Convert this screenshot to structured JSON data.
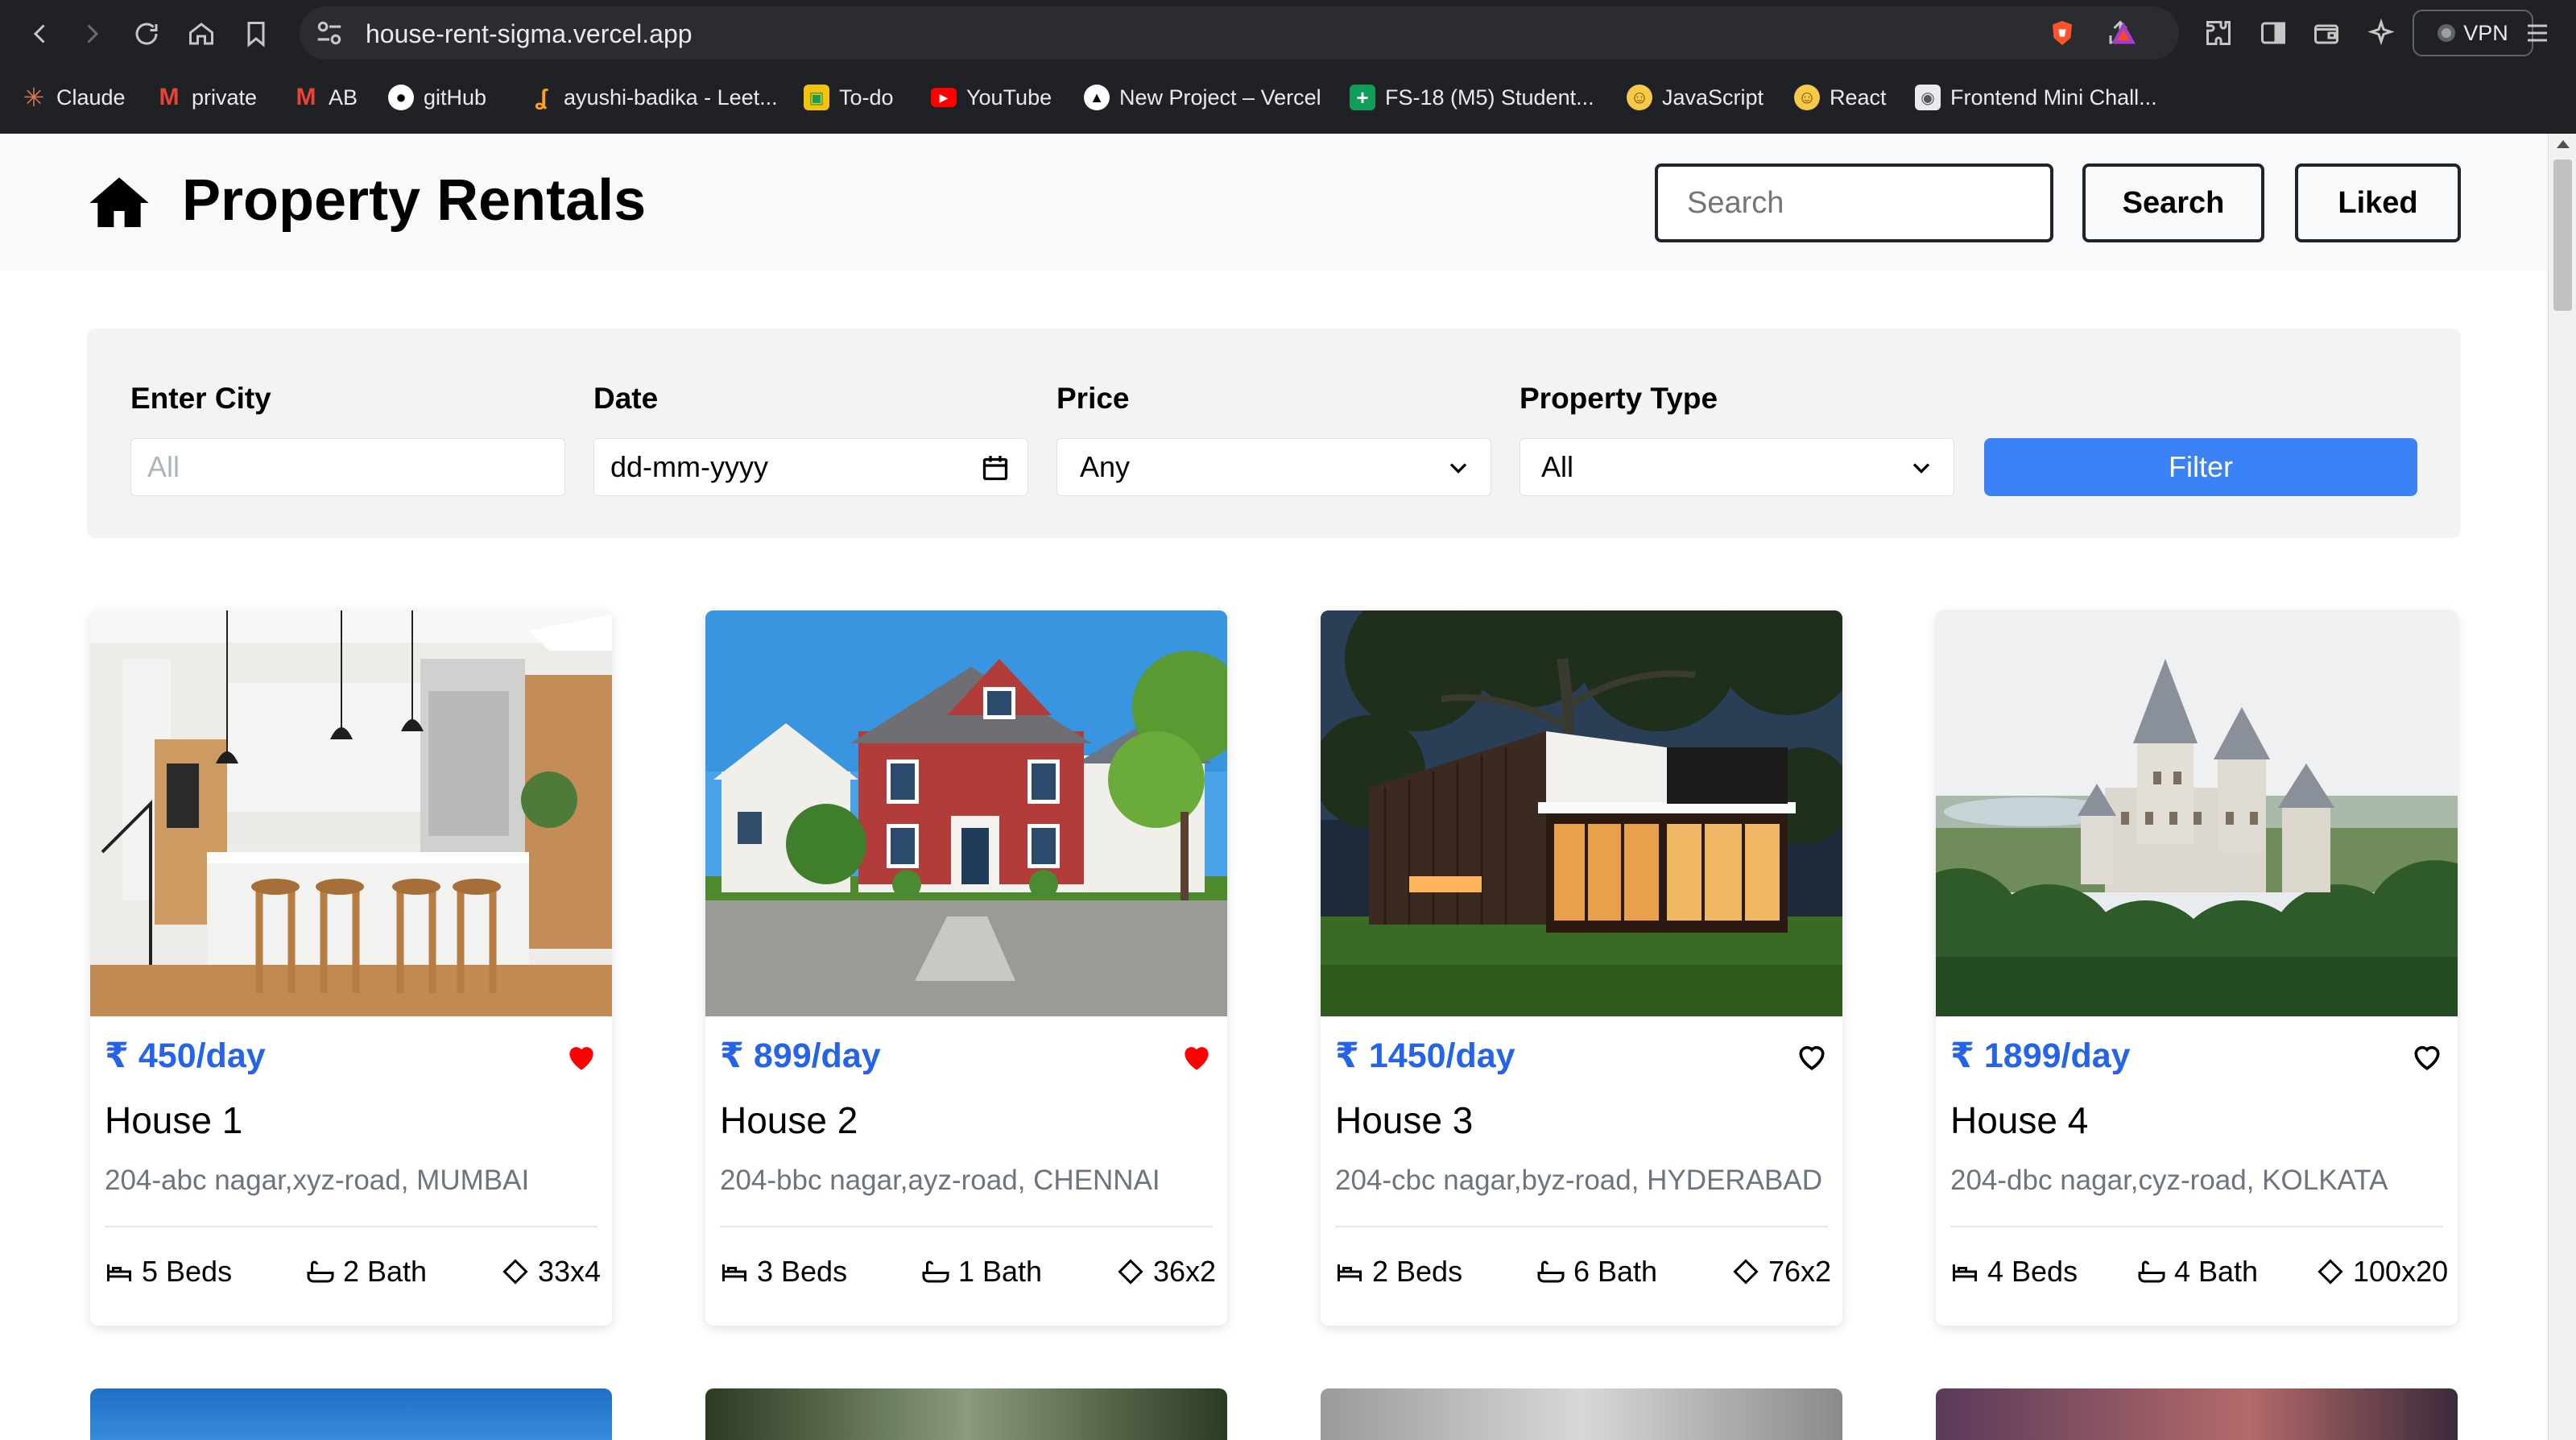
{
  "browser": {
    "url": "house-rent-sigma.vercel.app",
    "vpn_label": "VPN",
    "bookmarks": [
      {
        "label": "Claude",
        "icon": "claude-icon"
      },
      {
        "label": "private",
        "icon": "gmail-icon"
      },
      {
        "label": "AB",
        "icon": "gmail-icon"
      },
      {
        "label": "gitHub",
        "icon": "github-icon"
      },
      {
        "label": "ayushi-badika - Leet...",
        "icon": "leetcode-icon"
      },
      {
        "label": "To-do",
        "icon": "todo-icon"
      },
      {
        "label": "YouTube",
        "icon": "youtube-icon"
      },
      {
        "label": "New Project – Vercel",
        "icon": "vercel-icon"
      },
      {
        "label": "FS-18 (M5) Student...",
        "icon": "sheets-icon"
      },
      {
        "label": "JavaScript",
        "icon": "smiley-icon"
      },
      {
        "label": "React",
        "icon": "smiley-icon"
      },
      {
        "label": "Frontend Mini Chall...",
        "icon": "challenge-icon"
      }
    ]
  },
  "header": {
    "title": "Property Rentals",
    "search_placeholder": "Search",
    "search_button": "Search",
    "liked_button": "Liked"
  },
  "filters": {
    "city_label": "Enter City",
    "city_placeholder": "All",
    "date_label": "Date",
    "date_placeholder": "dd-mm-yyyy",
    "price_label": "Price",
    "price_value": "Any",
    "type_label": "Property Type",
    "type_value": "All",
    "filter_button": "Filter"
  },
  "colors": {
    "accent": "#3b82f6",
    "price": "#2563eb",
    "liked": "#ff0000"
  },
  "listings": [
    {
      "price": "₹ 450/day",
      "title": "House 1",
      "address": "204-abc nagar,xyz-road, MUMBAI",
      "beds": "5 Beds",
      "bath": "2 Bath",
      "area": "33x4",
      "liked": true
    },
    {
      "price": "₹ 899/day",
      "title": "House 2",
      "address": "204-bbc nagar,ayz-road, CHENNAI",
      "beds": "3 Beds",
      "bath": "1 Bath",
      "area": "36x2",
      "liked": true
    },
    {
      "price": "₹ 1450/day",
      "title": "House 3",
      "address": "204-cbc nagar,byz-road, HYDERABAD",
      "beds": "2 Beds",
      "bath": "6 Bath",
      "area": "76x2",
      "liked": false
    },
    {
      "price": "₹ 1899/day",
      "title": "House 4",
      "address": "204-dbc nagar,cyz-road, KOLKATA",
      "beds": "4 Beds",
      "bath": "4 Bath",
      "area": "100x20",
      "liked": false
    }
  ]
}
